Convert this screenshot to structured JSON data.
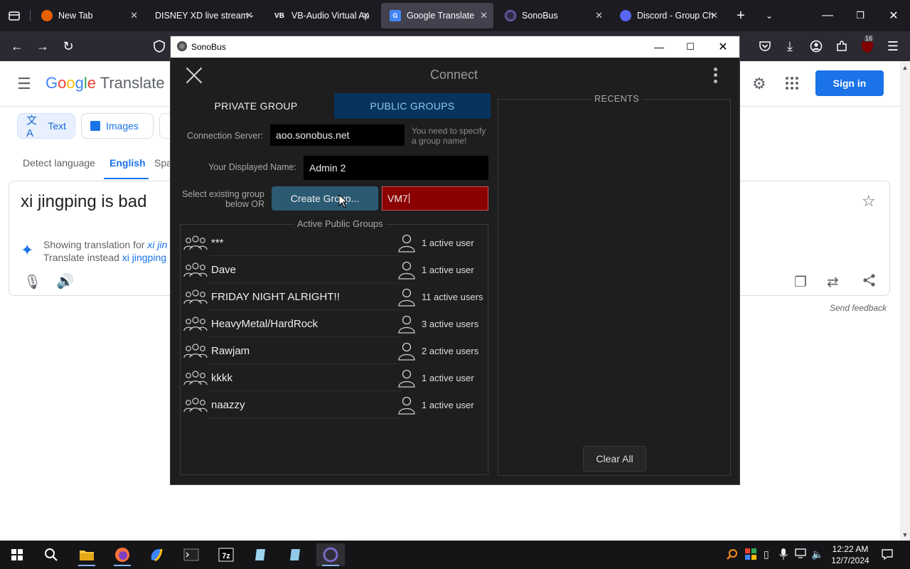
{
  "browser": {
    "tabs": [
      {
        "label": "New Tab",
        "icon": "firefox-icon"
      },
      {
        "label": "DISNEY XD live stream -",
        "icon": ""
      },
      {
        "label": "VB-Audio Virtual Ap",
        "icon": "vb-audio-icon"
      },
      {
        "label": "Google Translate",
        "icon": "google-translate-icon",
        "active": true
      },
      {
        "label": "SonoBus",
        "icon": "sonobus-icon"
      },
      {
        "label": "Discord - Group Ch",
        "icon": "discord-icon"
      }
    ],
    "extension_badge": "16"
  },
  "google_translate": {
    "logo_google": [
      "G",
      "o",
      "o",
      "g",
      "l",
      "e"
    ],
    "logo_product": "Translate",
    "modes": {
      "text": "Text",
      "images": "Images"
    },
    "languages": {
      "detect": "Detect language",
      "english": "English",
      "spanish_partial": "Spa"
    },
    "input_text": "xi jingping is bad",
    "suggest_line1_prefix": "Showing translation for ",
    "suggest_line1_link": "xi jin",
    "suggest_line2_prefix": "Translate instead ",
    "suggest_line2_link": "xi jingping",
    "sign_in": "Sign in",
    "send_feedback": "Send feedback"
  },
  "sonobus": {
    "window_title": "SonoBus",
    "header": "Connect",
    "tabs": {
      "private": "PRIVATE GROUP",
      "public": "PUBLIC GROUPS"
    },
    "connection_server_label": "Connection Server:",
    "connection_server_value": "aoo.sonobus.net",
    "hint_line1": "You need to specify",
    "hint_line2": "a group name!",
    "display_name_label": "Your Displayed Name:",
    "display_name_value": "Admin 2",
    "select_label_line1": "Select existing group",
    "select_label_line2": "below OR",
    "create_group": "Create Group...",
    "group_name_value": "VM7",
    "active_groups_title": "Active Public Groups",
    "groups": [
      {
        "name": "***",
        "users": "1 active user"
      },
      {
        "name": "Dave",
        "users": "1 active user"
      },
      {
        "name": "FRIDAY NIGHT ALRIGHT!!",
        "users": "11 active users"
      },
      {
        "name": "HeavyMetal/HardRock",
        "users": "3 active users"
      },
      {
        "name": "Rawjam",
        "users": "2 active users"
      },
      {
        "name": "kkkk",
        "users": "1 active user"
      },
      {
        "name": "naazzy",
        "users": "1 active user"
      }
    ],
    "recents_title": "RECENTS",
    "clear_all": "Clear All"
  },
  "taskbar": {
    "time": "12:22 AM",
    "date": "12/7/2024"
  }
}
